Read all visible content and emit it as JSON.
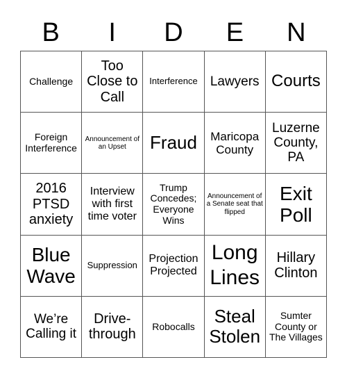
{
  "header": {
    "letters": [
      "B",
      "I",
      "D",
      "E",
      "N"
    ]
  },
  "grid": {
    "rows": [
      [
        "Challenge",
        "Too Close to Call",
        "Interference",
        "Lawyers",
        "Courts"
      ],
      [
        "Foreign Interference",
        "Announcement of an Upset",
        "Fraud",
        "Maricopa County",
        "Luzerne County, PA"
      ],
      [
        "2016 PTSD anxiety",
        "Interview with first time voter",
        "Trump Concedes; Everyone Wins",
        "Announcement of a Senate seat that flipped",
        "Exit Poll"
      ],
      [
        "Blue Wave",
        "Suppression",
        "Projection Projected",
        "Long Lines",
        "Hillary Clinton"
      ],
      [
        "We’re Calling it",
        "Drive-through",
        "Robocalls",
        "Steal Stolen",
        "Sumter County or The Villages"
      ]
    ]
  }
}
